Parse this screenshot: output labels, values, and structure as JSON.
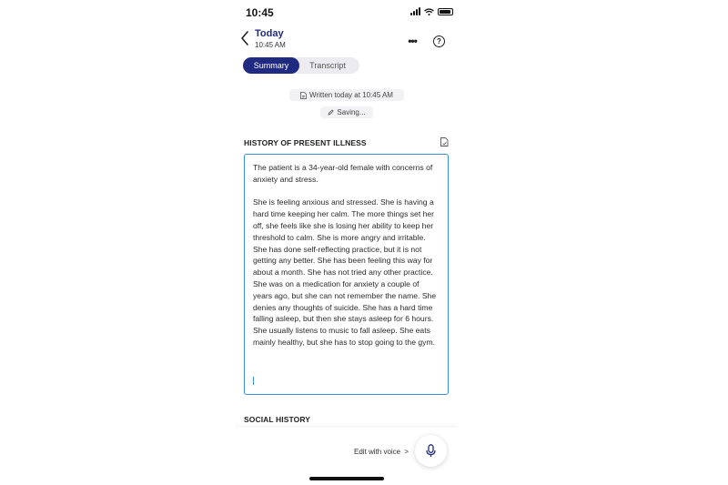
{
  "status_bar": {
    "time": "10:45"
  },
  "header": {
    "title": "Today",
    "subtitle": "10:45 AM",
    "more_icon": "ellipsis-icon",
    "help_icon": "question-circle-icon",
    "help_glyph": "?",
    "more_glyph": "•••"
  },
  "tabs": [
    {
      "label": "Summary",
      "active": true
    },
    {
      "label": "Transcript",
      "active": false
    }
  ],
  "meta": {
    "written": "Written today at 10:45 AM",
    "saving": "Saving..."
  },
  "sections": {
    "hpi_title": "HISTORY OF PRESENT ILLNESS",
    "hpi_text": "The patient is a 34-year-old female with concerns of anxiety and stress.\n\nShe is feeling anxious and stressed. She is having a hard time keeping her calm. The more things set her off, she feels like she is losing her ability to keep her threshold to calm. She is more angry and irritable. She has done self-reflecting practice, but it is not getting any better. She has been feeling this way for about a month. She has not tried any other practice. She was on a medication for anxiety a couple of years ago, but she can not remember the name. She denies any thoughts of suicide. She has a hard time falling asleep, but then she stays asleep for 6 hours. She usually listens to music to fall asleep. She eats mainly healthy, but she has to stop going to the gym.",
    "social_title": "SOCIAL HISTORY"
  },
  "bottom": {
    "voice_label": "Edit with voice",
    "voice_chevron": ">"
  },
  "colors": {
    "accent": "#1f2a80",
    "focus_border": "#3a8fd8"
  }
}
